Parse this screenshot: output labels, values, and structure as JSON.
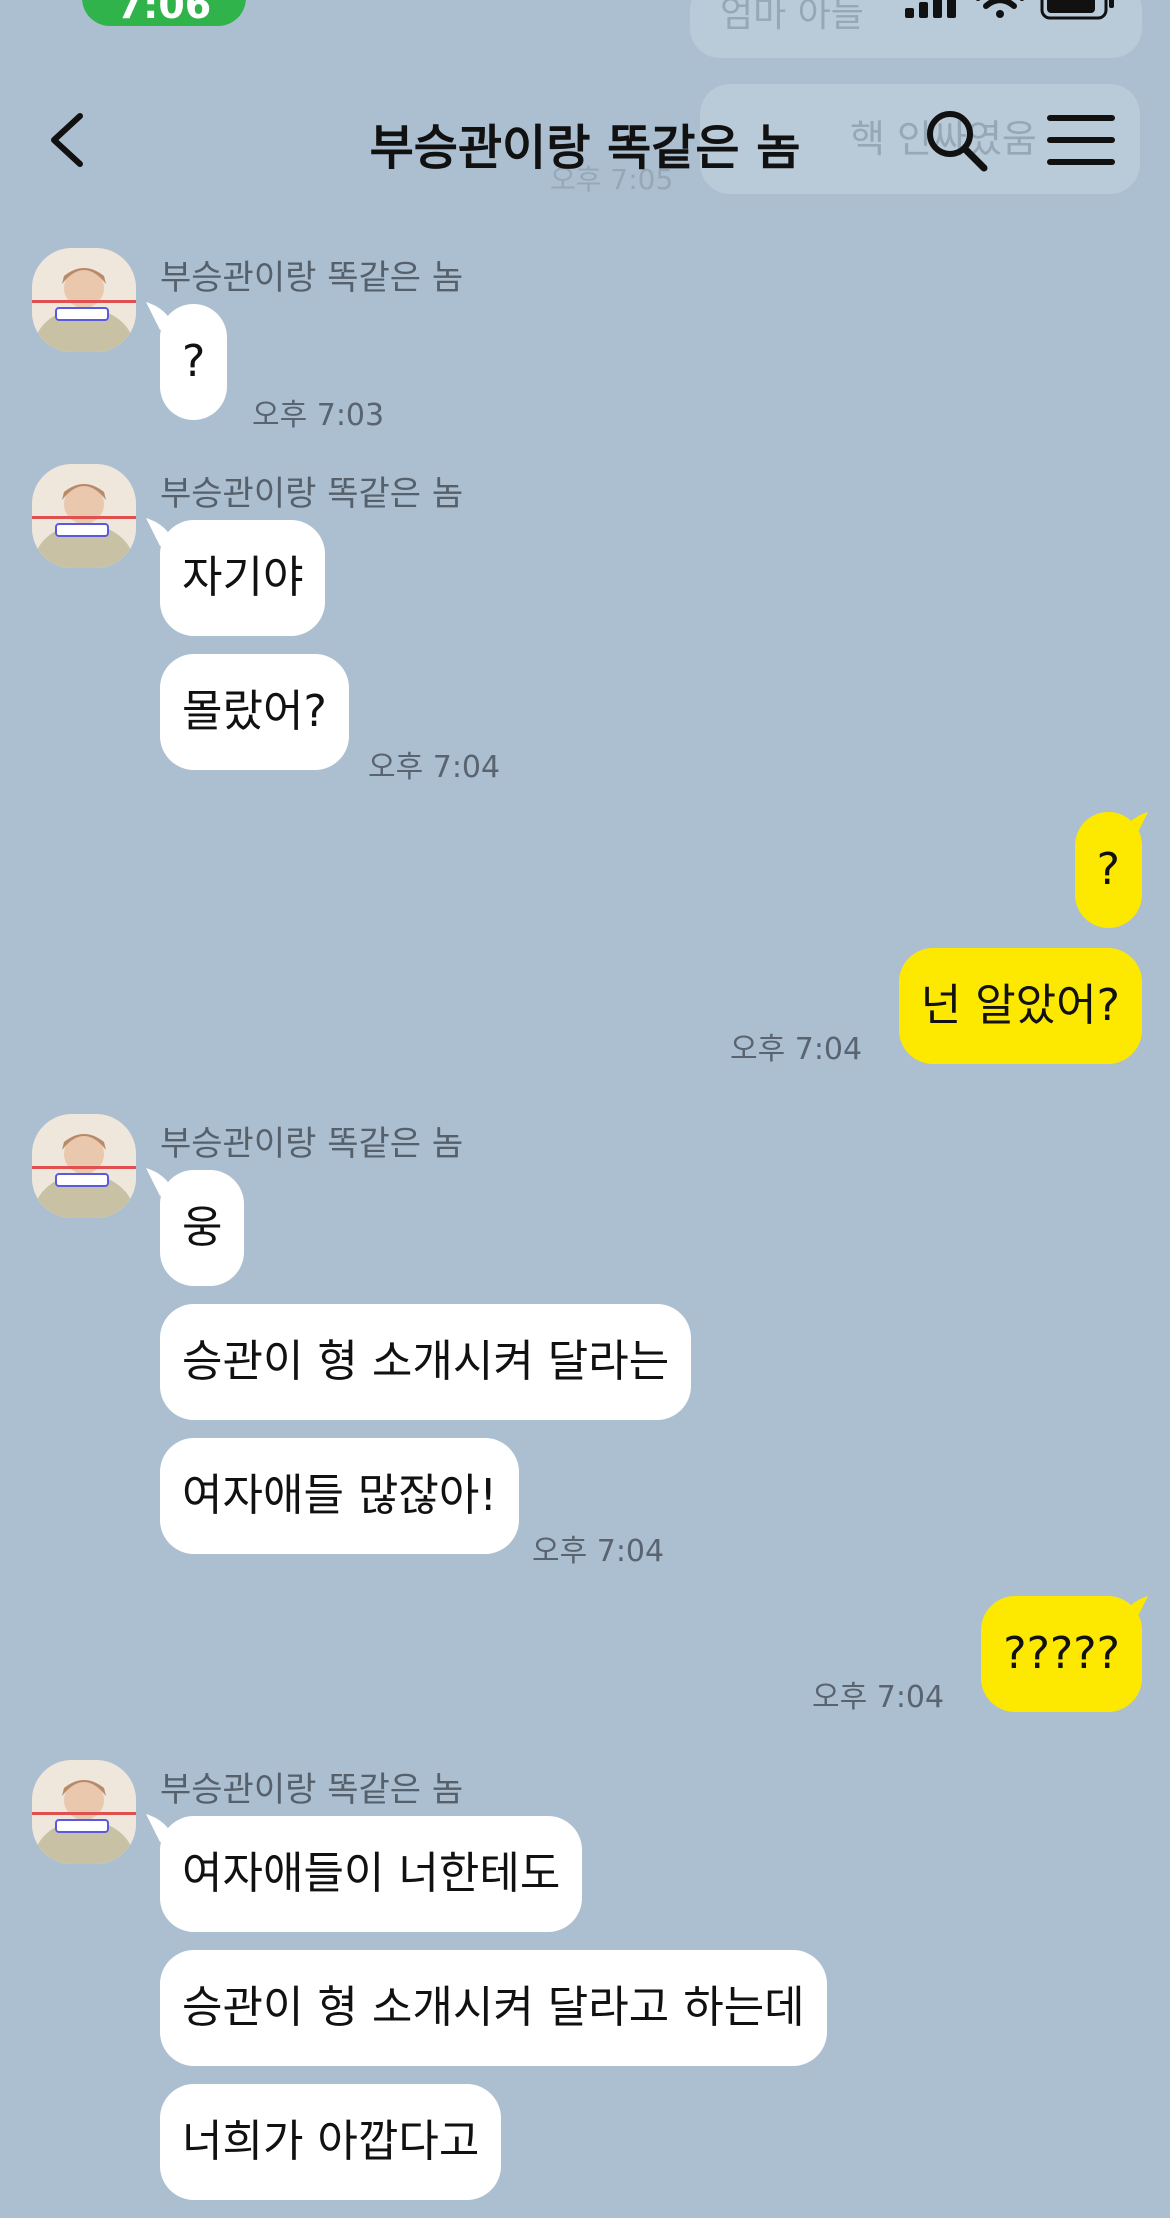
{
  "status": {
    "time": "7:06"
  },
  "overlay": {
    "ghost_text_1": "엄마 아들",
    "ghost_text_2": "핵 인싸였움",
    "ghost_time": "오후 7:05"
  },
  "header": {
    "title": "부승관이랑 똑같은 놈"
  },
  "icons": {
    "back": "chevron-left-icon",
    "search": "search-icon",
    "menu": "hamburger-menu-icon"
  },
  "colors": {
    "background": "#abbfd1",
    "incoming_bubble": "#ffffff",
    "outgoing_bubble": "#fde800",
    "status_pill": "#2fb34a"
  },
  "chat": {
    "group1": {
      "sender": "부승관이랑 똑같은 놈",
      "messages": [
        "?"
      ],
      "time": "오후 7:03"
    },
    "group2": {
      "sender": "부승관이랑 똑같은 놈",
      "messages": [
        "자기야",
        "몰랐어?"
      ],
      "time": "오후 7:04"
    },
    "group3": {
      "messages": [
        "?",
        "넌 알았어?"
      ],
      "time": "오후 7:04"
    },
    "group4": {
      "sender": "부승관이랑 똑같은 놈",
      "messages": [
        "웅",
        "승관이 형 소개시켜 달라는",
        "여자애들 많잖아!"
      ],
      "time": "오후 7:04"
    },
    "group5": {
      "messages": [
        "?????"
      ],
      "time": "오후 7:04"
    },
    "group6": {
      "sender": "부승관이랑 똑같은 놈",
      "messages": [
        "여자애들이 너한테도",
        "승관이 형 소개시켜 달라고 하는데",
        "너희가 아깝다고"
      ]
    }
  }
}
